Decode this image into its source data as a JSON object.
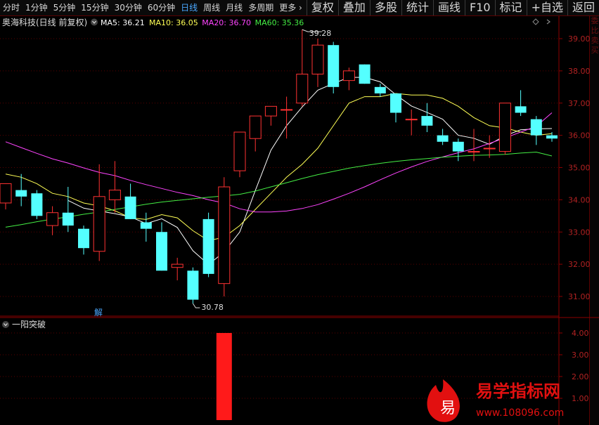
{
  "toolbar": {
    "periods": [
      "分时",
      "1分钟",
      "5分钟",
      "15分钟",
      "30分钟",
      "60分钟",
      "日线",
      "周线",
      "月线",
      "多周期",
      "更多"
    ],
    "active": "日线",
    "more_icon": "chevron-right-icon",
    "right_items": [
      "复权",
      "叠加",
      "多股",
      "统计",
      "画线",
      "F10",
      "标记",
      "+自选",
      "返回"
    ]
  },
  "side_strip": "委比卖买",
  "main_legend": {
    "stock": "奥海科技(日线 前复权)",
    "toggle_icon": "circle-chevron-down-icon",
    "ma": [
      {
        "label": "MA5: 36.21",
        "color": "#ffffff"
      },
      {
        "label": "MA10: 36.05",
        "color": "#ffff55"
      },
      {
        "label": "MA20: 36.70",
        "color": "#ff44ff"
      },
      {
        "label": "MA60: 35.36",
        "color": "#44ee44"
      }
    ]
  },
  "markers": {
    "high": "39.28",
    "low": "30.78",
    "signal": "解"
  },
  "sub_legend": {
    "title": "一阳突破"
  },
  "watermark": {
    "site": "易学指标网",
    "url": "www.108096.com",
    "logo_char": "易"
  },
  "chart_data": [
    {
      "type": "candlestick",
      "ylim": [
        30.6,
        39.4
      ],
      "yticks": [
        "39.00",
        "38.00",
        "37.00",
        "36.00",
        "35.00",
        "34.00",
        "33.00",
        "32.00",
        "31.00"
      ],
      "colors": {
        "up": "#ff3232",
        "down": "#54ffff"
      },
      "candles": [
        {
          "o": 33.9,
          "h": 34.5,
          "l": 33.7,
          "c": 34.5
        },
        {
          "o": 34.3,
          "h": 34.8,
          "l": 33.8,
          "c": 34.1
        },
        {
          "o": 34.2,
          "h": 34.3,
          "l": 33.4,
          "c": 33.5
        },
        {
          "o": 33.2,
          "h": 33.8,
          "l": 32.9,
          "c": 33.6
        },
        {
          "o": 33.6,
          "h": 34.4,
          "l": 33.0,
          "c": 33.2
        },
        {
          "o": 33.1,
          "h": 33.2,
          "l": 32.3,
          "c": 32.5
        },
        {
          "o": 32.4,
          "h": 35.1,
          "l": 32.1,
          "c": 34.1
        },
        {
          "o": 34.0,
          "h": 35.2,
          "l": 33.6,
          "c": 34.3
        },
        {
          "o": 34.1,
          "h": 34.5,
          "l": 33.4,
          "c": 33.4
        },
        {
          "o": 33.3,
          "h": 33.6,
          "l": 32.7,
          "c": 33.1
        },
        {
          "o": 33.0,
          "h": 33.3,
          "l": 31.8,
          "c": 31.8
        },
        {
          "o": 31.9,
          "h": 32.2,
          "l": 31.5,
          "c": 32.0
        },
        {
          "o": 31.8,
          "h": 31.9,
          "l": 30.78,
          "c": 30.9
        },
        {
          "o": 33.4,
          "h": 33.6,
          "l": 31.6,
          "c": 31.7
        },
        {
          "o": 31.4,
          "h": 34.7,
          "l": 31.0,
          "c": 34.4
        },
        {
          "o": 34.9,
          "h": 35.6,
          "l": 34.7,
          "c": 36.1
        },
        {
          "o": 35.9,
          "h": 36.6,
          "l": 35.5,
          "c": 36.6
        },
        {
          "o": 36.6,
          "h": 36.9,
          "l": 36.3,
          "c": 36.9
        },
        {
          "o": 36.8,
          "h": 37.2,
          "l": 35.9,
          "c": 36.8
        },
        {
          "o": 37.0,
          "h": 39.28,
          "l": 36.9,
          "c": 37.9
        },
        {
          "o": 37.9,
          "h": 39.0,
          "l": 37.5,
          "c": 38.8
        },
        {
          "o": 38.8,
          "h": 38.9,
          "l": 37.3,
          "c": 37.5
        },
        {
          "o": 37.7,
          "h": 38.1,
          "l": 37.4,
          "c": 38.0
        },
        {
          "o": 38.2,
          "h": 38.2,
          "l": 37.6,
          "c": 37.6
        },
        {
          "o": 37.5,
          "h": 37.6,
          "l": 37.2,
          "c": 37.3
        },
        {
          "o": 37.3,
          "h": 37.3,
          "l": 36.4,
          "c": 36.7
        },
        {
          "o": 36.5,
          "h": 36.8,
          "l": 36.0,
          "c": 36.5
        },
        {
          "o": 36.6,
          "h": 37.0,
          "l": 36.1,
          "c": 36.3
        },
        {
          "o": 36.0,
          "h": 36.2,
          "l": 35.7,
          "c": 35.8
        },
        {
          "o": 35.8,
          "h": 35.9,
          "l": 35.2,
          "c": 35.5
        },
        {
          "o": 35.5,
          "h": 36.2,
          "l": 35.2,
          "c": 35.5
        },
        {
          "o": 35.6,
          "h": 36.0,
          "l": 35.3,
          "c": 35.6
        },
        {
          "o": 35.5,
          "h": 37.0,
          "l": 35.4,
          "c": 37.0
        },
        {
          "o": 36.9,
          "h": 37.4,
          "l": 36.6,
          "c": 36.7
        },
        {
          "o": 36.5,
          "h": 36.6,
          "l": 35.7,
          "c": 36.0
        },
        {
          "o": 36.0,
          "h": 36.1,
          "l": 35.8,
          "c": 35.9
        }
      ],
      "ma_lines": [
        {
          "name": "MA5",
          "color": "#ffffff",
          "values": [
            null,
            null,
            null,
            null,
            33.98,
            33.74,
            33.65,
            33.57,
            33.47,
            33.26,
            33.41,
            33.14,
            32.42,
            31.99,
            32.38,
            33.0,
            34.29,
            35.54,
            36.3,
            36.88,
            37.4,
            37.61,
            37.8,
            37.8,
            37.66,
            37.26,
            36.91,
            36.71,
            36.5,
            36.0,
            35.91,
            35.72,
            35.99,
            36.17,
            36.2,
            36.21
          ]
        },
        {
          "name": "MA10",
          "color": "#ffff55",
          "values": [
            34.8,
            34.7,
            34.5,
            34.2,
            34.1,
            33.9,
            33.81,
            33.66,
            33.44,
            33.39,
            33.54,
            33.44,
            33.04,
            32.73,
            32.84,
            33.2,
            33.7,
            34.2,
            34.7,
            35.1,
            35.6,
            36.3,
            37.0,
            37.2,
            37.2,
            37.3,
            37.25,
            37.25,
            37.15,
            36.9,
            36.55,
            36.3,
            36.23,
            36.1,
            36.0,
            36.05
          ]
        },
        {
          "name": "MA20",
          "color": "#ff44ff",
          "values": [
            35.8,
            35.62,
            35.44,
            35.27,
            35.14,
            34.99,
            34.85,
            34.75,
            34.6,
            34.47,
            34.35,
            34.23,
            34.13,
            34.0,
            33.9,
            33.72,
            33.62,
            33.62,
            33.65,
            33.73,
            33.85,
            34.02,
            34.2,
            34.4,
            34.62,
            34.83,
            35.02,
            35.19,
            35.33,
            35.46,
            35.58,
            35.75,
            35.92,
            36.1,
            36.28,
            36.7
          ]
        },
        {
          "name": "MA60",
          "color": "#44ee44",
          "values": [
            33.15,
            33.23,
            33.32,
            33.4,
            33.47,
            33.55,
            33.62,
            33.7,
            33.78,
            33.86,
            33.93,
            33.98,
            34.03,
            34.08,
            34.12,
            34.17,
            34.27,
            34.4,
            34.53,
            34.66,
            34.78,
            34.88,
            34.98,
            35.06,
            35.13,
            35.19,
            35.24,
            35.28,
            35.32,
            35.35,
            35.38,
            35.39,
            35.41,
            35.45,
            35.48,
            35.36
          ]
        }
      ]
    },
    {
      "type": "bar",
      "series": [
        {
          "values": [
            0,
            0,
            0,
            0,
            0,
            0,
            0,
            0,
            0,
            0,
            0,
            0,
            0,
            0,
            4,
            0,
            0,
            0,
            0,
            0,
            0,
            0,
            0,
            0,
            0,
            0,
            0,
            0,
            0,
            0,
            0,
            0,
            0,
            0,
            0,
            0
          ]
        }
      ],
      "ylim": [
        0,
        4.4
      ],
      "yticks": [
        "4.00",
        "3.00",
        "2.00",
        "1.00"
      ],
      "color": "#ff1a1a"
    }
  ]
}
